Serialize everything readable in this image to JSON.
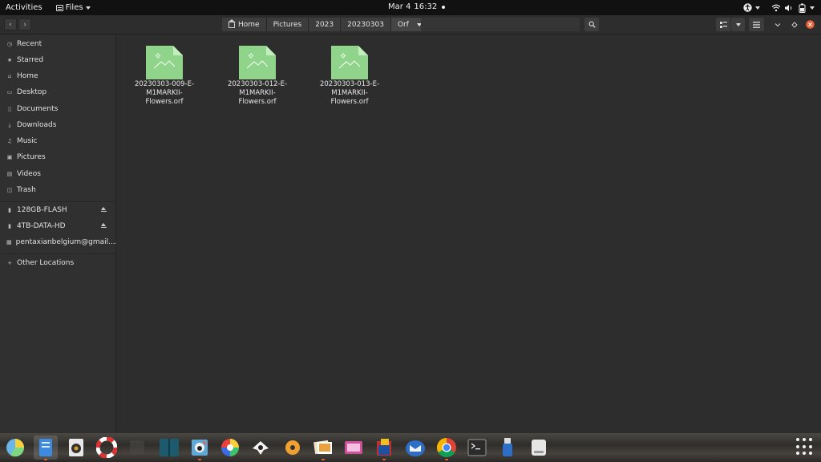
{
  "topbar": {
    "activities": "Activities",
    "app_menu": "Files",
    "date": "Mar 4",
    "time": "16:32"
  },
  "breadcrumb": {
    "items": [
      {
        "label": "Home"
      },
      {
        "label": "Pictures"
      },
      {
        "label": "2023"
      },
      {
        "label": "20230303"
      },
      {
        "label": "Orf"
      }
    ]
  },
  "sidebar": {
    "places": [
      {
        "label": "Recent",
        "icon": "clock-icon"
      },
      {
        "label": "Starred",
        "icon": "star-icon"
      },
      {
        "label": "Home",
        "icon": "home-icon"
      },
      {
        "label": "Desktop",
        "icon": "desktop-icon"
      },
      {
        "label": "Documents",
        "icon": "document-icon"
      },
      {
        "label": "Downloads",
        "icon": "download-icon"
      },
      {
        "label": "Music",
        "icon": "music-icon"
      },
      {
        "label": "Pictures",
        "icon": "picture-icon"
      },
      {
        "label": "Videos",
        "icon": "video-icon"
      },
      {
        "label": "Trash",
        "icon": "trash-icon"
      }
    ],
    "devices": [
      {
        "label": "128GB-FLASH",
        "icon": "drive-icon"
      },
      {
        "label": "4TB-DATA-HD",
        "icon": "drive-icon"
      },
      {
        "label": "pentaxianbelgium@gmail....",
        "icon": "online-account-icon"
      }
    ],
    "other": {
      "label": "Other Locations",
      "icon": "plus-icon"
    }
  },
  "files": [
    {
      "name": "20230303-009-E-M1MARKII-Flowers.orf"
    },
    {
      "name": "20230303-012-E-M1MARKII-Flowers.orf"
    },
    {
      "name": "20230303-013-E-M1MARKII-Flowers.orf"
    }
  ],
  "colors": {
    "thumbnail": "#8fd48a",
    "accent": "#e8623a"
  },
  "dock": {
    "apps": [
      "pie-chart-icon",
      "files-icon",
      "music-player-icon",
      "help-icon",
      "unknown-app-icon",
      "book-icon",
      "gimp-icon",
      "color-picker-icon",
      "inkscape-icon",
      "rhythmbox-icon",
      "photos-icon",
      "image-viewer-icon",
      "archive-icon",
      "mail-icon",
      "chrome-icon",
      "terminal-icon",
      "usb-icon",
      "disk-icon"
    ]
  }
}
